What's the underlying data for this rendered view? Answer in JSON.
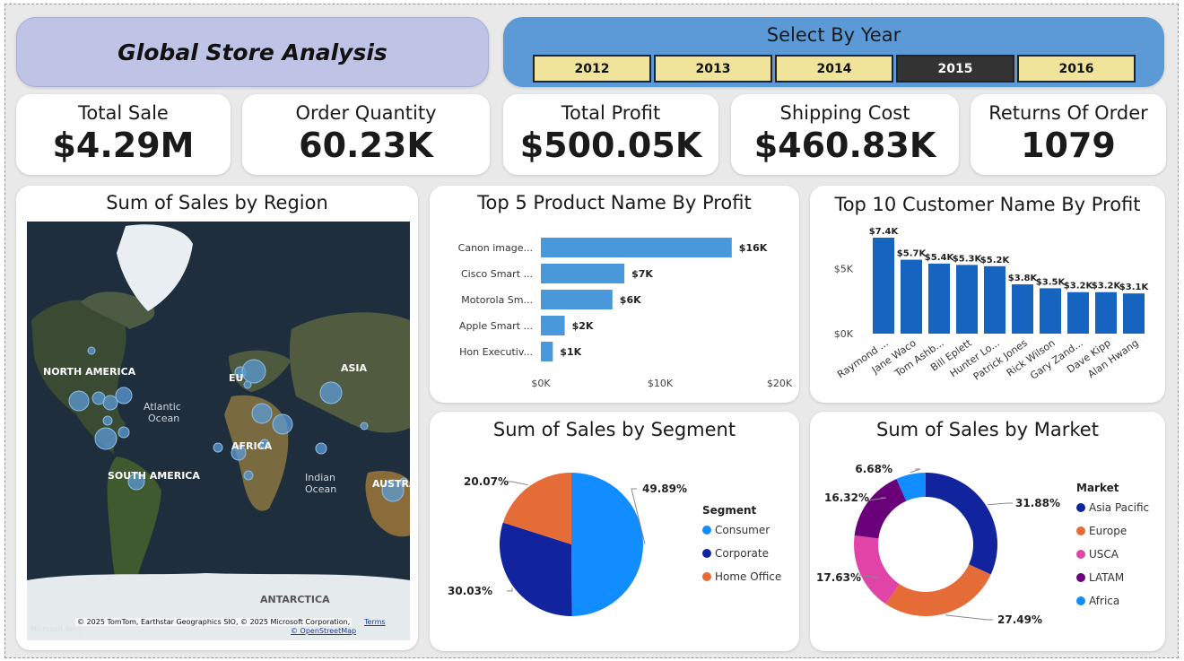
{
  "header": {
    "title": "Global Store Analysis"
  },
  "year_slicer": {
    "title": "Select By Year",
    "years": [
      "2012",
      "2013",
      "2014",
      "2015",
      "2016"
    ],
    "selected": "2015"
  },
  "kpis": [
    {
      "label": "Total Sale",
      "value": "$4.29M"
    },
    {
      "label": "Order Quantity",
      "value": "60.23K"
    },
    {
      "label": "Total Profit",
      "value": "$500.05K"
    },
    {
      "label": "Shipping Cost",
      "value": "$460.83K"
    },
    {
      "label": "Returns Of Order",
      "value": "1079"
    }
  ],
  "map": {
    "title": "Sum of Sales by Region",
    "labels": {
      "north_america": "NORTH AMERICA",
      "south_america": "SOUTH AMERICA",
      "europe": "EU",
      "africa": "AFRICA",
      "asia": "ASIA",
      "australia": "AUSTRA",
      "antarctica": "ANTARCTICA",
      "atlantic": "Atlantic",
      "atlantic2": "Ocean",
      "indian": "Indian",
      "indian2": "Ocean"
    },
    "attribution": "© 2025 TomTom, Earthstar Geographics SIO, © 2025 Microsoft Corporation,",
    "terms": "Terms",
    "osm": "© OpenStreetMap",
    "logo": "Microsoft Bing",
    "bubble_color": "#5b9bd5"
  },
  "chart_data": [
    {
      "type": "bar",
      "orientation": "horizontal",
      "title": "Top 5 Product Name By Profit",
      "categories": [
        "Canon image...",
        "Cisco Smart ...",
        "Motorola Sm...",
        "Apple Smart ...",
        "Hon Executiv..."
      ],
      "values": [
        16000,
        7000,
        6000,
        2000,
        1000
      ],
      "data_labels": [
        "$16K",
        "$7K",
        "$6K",
        "$2K",
        "$1K"
      ],
      "xlim": [
        0,
        20000
      ],
      "xticks": [
        "$0K",
        "$10K",
        "$20K"
      ],
      "color": "#4a98dc"
    },
    {
      "type": "bar",
      "title": "Top 10 Customer Name By Profit",
      "categories": [
        "Raymond ...",
        "Jane Waco",
        "Tom Ashb...",
        "Bill Eplett",
        "Hunter Lo...",
        "Patrick Jones",
        "Rick Wilson",
        "Gary Zand...",
        "Dave Kipp",
        "Alan Hwang"
      ],
      "values": [
        7400,
        5700,
        5400,
        5300,
        5200,
        3800,
        3500,
        3200,
        3200,
        3100
      ],
      "data_labels": [
        "$7.4K",
        "$5.7K",
        "$5.4K",
        "$5.3K",
        "$5.2K",
        "$3.8K",
        "$3.5K",
        "$3.2K",
        "$3.2K",
        "$3.1K"
      ],
      "ylim": [
        0,
        7400
      ],
      "yticks": [
        "$0K",
        "$5K"
      ],
      "color": "#1565c0"
    },
    {
      "type": "pie",
      "title": "Sum of Sales by Segment",
      "legend_title": "Segment",
      "categories": [
        "Consumer",
        "Corporate",
        "Home Office"
      ],
      "values": [
        49.89,
        30.03,
        20.07
      ],
      "data_labels": [
        "49.89%",
        "30.03%",
        "20.07%"
      ],
      "colors": [
        "#118dff",
        "#12239e",
        "#e66c37"
      ]
    },
    {
      "type": "donut",
      "title": "Sum of Sales by Market",
      "legend_title": "Market",
      "categories": [
        "Asia Pacific",
        "Europe",
        "USCA",
        "LATAM",
        "Africa"
      ],
      "values": [
        31.88,
        27.49,
        17.63,
        16.32,
        6.68
      ],
      "data_labels": [
        "31.88%",
        "27.49%",
        "17.63%",
        "16.32%",
        "6.68%"
      ],
      "colors": [
        "#12239e",
        "#e66c37",
        "#e044a7",
        "#6b007b",
        "#118dff"
      ]
    }
  ]
}
